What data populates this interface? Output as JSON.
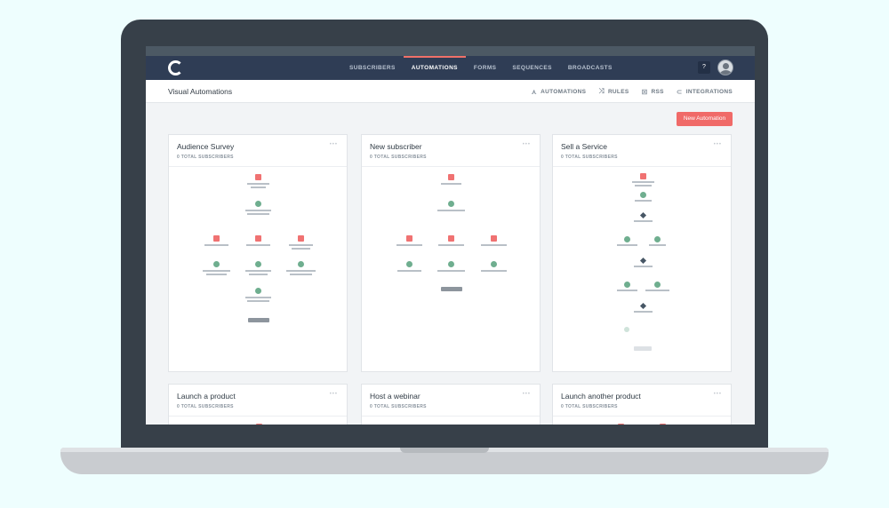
{
  "nav": {
    "items": [
      "SUBSCRIBERS",
      "AUTOMATIONS",
      "FORMS",
      "SEQUENCES",
      "BROADCASTS"
    ],
    "help": "?"
  },
  "header": {
    "title": "Visual Automations",
    "subnav": [
      {
        "label": "AUTOMATIONS",
        "icon": "automations-icon"
      },
      {
        "label": "RULES",
        "icon": "rules-icon"
      },
      {
        "label": "RSS",
        "icon": "rss-icon"
      },
      {
        "label": "INTEGRATIONS",
        "icon": "integrations-icon"
      }
    ]
  },
  "new_button": "New Automation",
  "cards": [
    {
      "title": "Audience Survey",
      "subscribers": "0 TOTAL SUBSCRIBERS"
    },
    {
      "title": "New subscriber",
      "subscribers": "0 TOTAL SUBSCRIBERS"
    },
    {
      "title": "Sell a Service",
      "subscribers": "0 TOTAL SUBSCRIBERS"
    },
    {
      "title": "Launch a product",
      "subscribers": "0 TOTAL SUBSCRIBERS"
    },
    {
      "title": "Host a webinar",
      "subscribers": "0 TOTAL SUBSCRIBERS"
    },
    {
      "title": "Launch another product",
      "subscribers": "0 TOTAL SUBSCRIBERS"
    }
  ],
  "colors": {
    "nav_bg": "#2f3d55",
    "accent": "#f06a68",
    "node_event": "#f07272",
    "node_action": "#6fae8f",
    "node_condition": "#475665"
  }
}
